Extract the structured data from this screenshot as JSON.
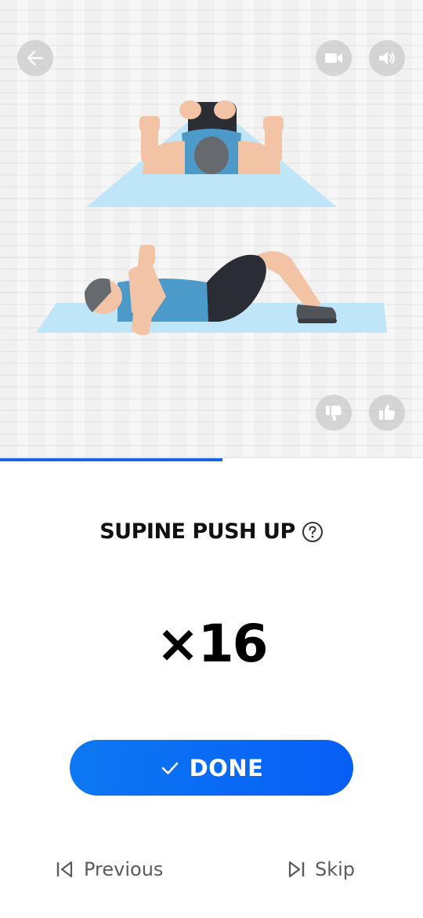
{
  "illustration": {
    "back_icon": "arrow-left-icon",
    "video_icon": "video-camera-icon",
    "sound_icon": "speaker-volume-icon",
    "dislike_icon": "thumbs-down-icon",
    "like_icon": "thumbs-up-icon"
  },
  "progress": {
    "fraction": 0.526,
    "color": "#1565e6"
  },
  "exercise": {
    "name": "SUPINE PUSH UP",
    "reps": "×16",
    "help_icon": "question-circle-icon"
  },
  "done_button": {
    "label": "DONE",
    "icon": "checkmark-icon",
    "color": "#0b6cf4"
  },
  "navigation": {
    "previous_label": "Previous",
    "previous_icon": "skip-previous-icon",
    "skip_label": "Skip",
    "skip_icon": "skip-next-icon"
  },
  "colors": {
    "mat": "#bfe6f8",
    "shirt": "#4b9ac9",
    "skin": "#f2c3a5",
    "shorts": "#2a2e34"
  }
}
